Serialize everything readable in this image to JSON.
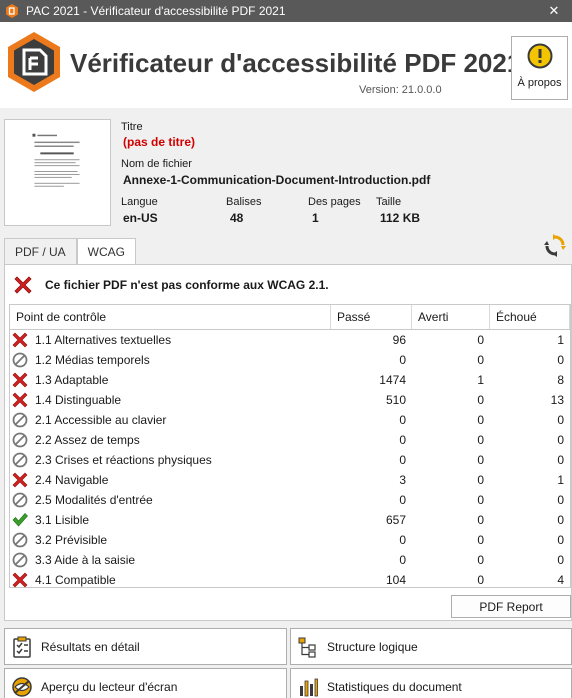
{
  "window": {
    "title": "PAC 2021 - Vérificateur d'accessibilité PDF 2021",
    "close_glyph": "✕"
  },
  "header": {
    "title": "Vérificateur d'accessibilité PDF 2021",
    "version": "Version: 21.0.0.0",
    "about_label": "À propos",
    "brand_color": "#ec7a1c"
  },
  "document": {
    "title_label": "Titre",
    "title_value": "(pas de titre)",
    "filename_label": "Nom de fichier",
    "filename_value": "Annexe-1-Communication-Document-Introduction.pdf",
    "language_label": "Langue",
    "language_value": "en-US",
    "tags_label": "Balises",
    "tags_value": "48",
    "pages_label": "Des pages",
    "pages_value": "1",
    "size_label": "Taille",
    "size_value": "112 KB"
  },
  "tabs": [
    {
      "label": "PDF / UA",
      "active": false
    },
    {
      "label": "WCAG",
      "active": true
    }
  ],
  "result": {
    "status_icon": "fail-icon",
    "message": "Ce fichier PDF n'est pas conforme aux WCAG 2.1."
  },
  "table": {
    "columns": [
      "Point de contrôle",
      "Passé",
      "Averti",
      "Échoué"
    ],
    "rows": [
      {
        "status": "fail",
        "label": "1.1 Alternatives textuelles",
        "passed": "96",
        "warned": "0",
        "failed": "1"
      },
      {
        "status": "na",
        "label": "1.2 Médias temporels",
        "passed": "0",
        "warned": "0",
        "failed": "0"
      },
      {
        "status": "fail",
        "label": "1.3 Adaptable",
        "passed": "1474",
        "warned": "1",
        "failed": "8"
      },
      {
        "status": "fail",
        "label": "1.4 Distinguable",
        "passed": "510",
        "warned": "0",
        "failed": "13"
      },
      {
        "status": "na",
        "label": "2.1 Accessible au clavier",
        "passed": "0",
        "warned": "0",
        "failed": "0"
      },
      {
        "status": "na",
        "label": "2.2 Assez de temps",
        "passed": "0",
        "warned": "0",
        "failed": "0"
      },
      {
        "status": "na",
        "label": "2.3 Crises et réactions physiques",
        "passed": "0",
        "warned": "0",
        "failed": "0"
      },
      {
        "status": "fail",
        "label": "2.4 Navigable",
        "passed": "3",
        "warned": "0",
        "failed": "1"
      },
      {
        "status": "na",
        "label": "2.5 Modalités d'entrée",
        "passed": "0",
        "warned": "0",
        "failed": "0"
      },
      {
        "status": "pass",
        "label": "3.1 Lisible",
        "passed": "657",
        "warned": "0",
        "failed": "0"
      },
      {
        "status": "na",
        "label": "3.2 Prévisible",
        "passed": "0",
        "warned": "0",
        "failed": "0"
      },
      {
        "status": "na",
        "label": "3.3 Aide à la saisie",
        "passed": "0",
        "warned": "0",
        "failed": "0"
      },
      {
        "status": "fail",
        "label": "4.1 Compatible",
        "passed": "104",
        "warned": "0",
        "failed": "4"
      }
    ]
  },
  "actions": {
    "pdf_report": "PDF Report",
    "detailed_results": "Résultats en détail",
    "logical_structure": "Structure logique",
    "screen_reader_preview": "Aperçu du lecteur d'écran",
    "document_statistics": "Statistiques du document"
  },
  "colors": {
    "fail": "#d42020",
    "pass": "#3aa02a",
    "na": "#777777",
    "title_red": "#d00000"
  }
}
